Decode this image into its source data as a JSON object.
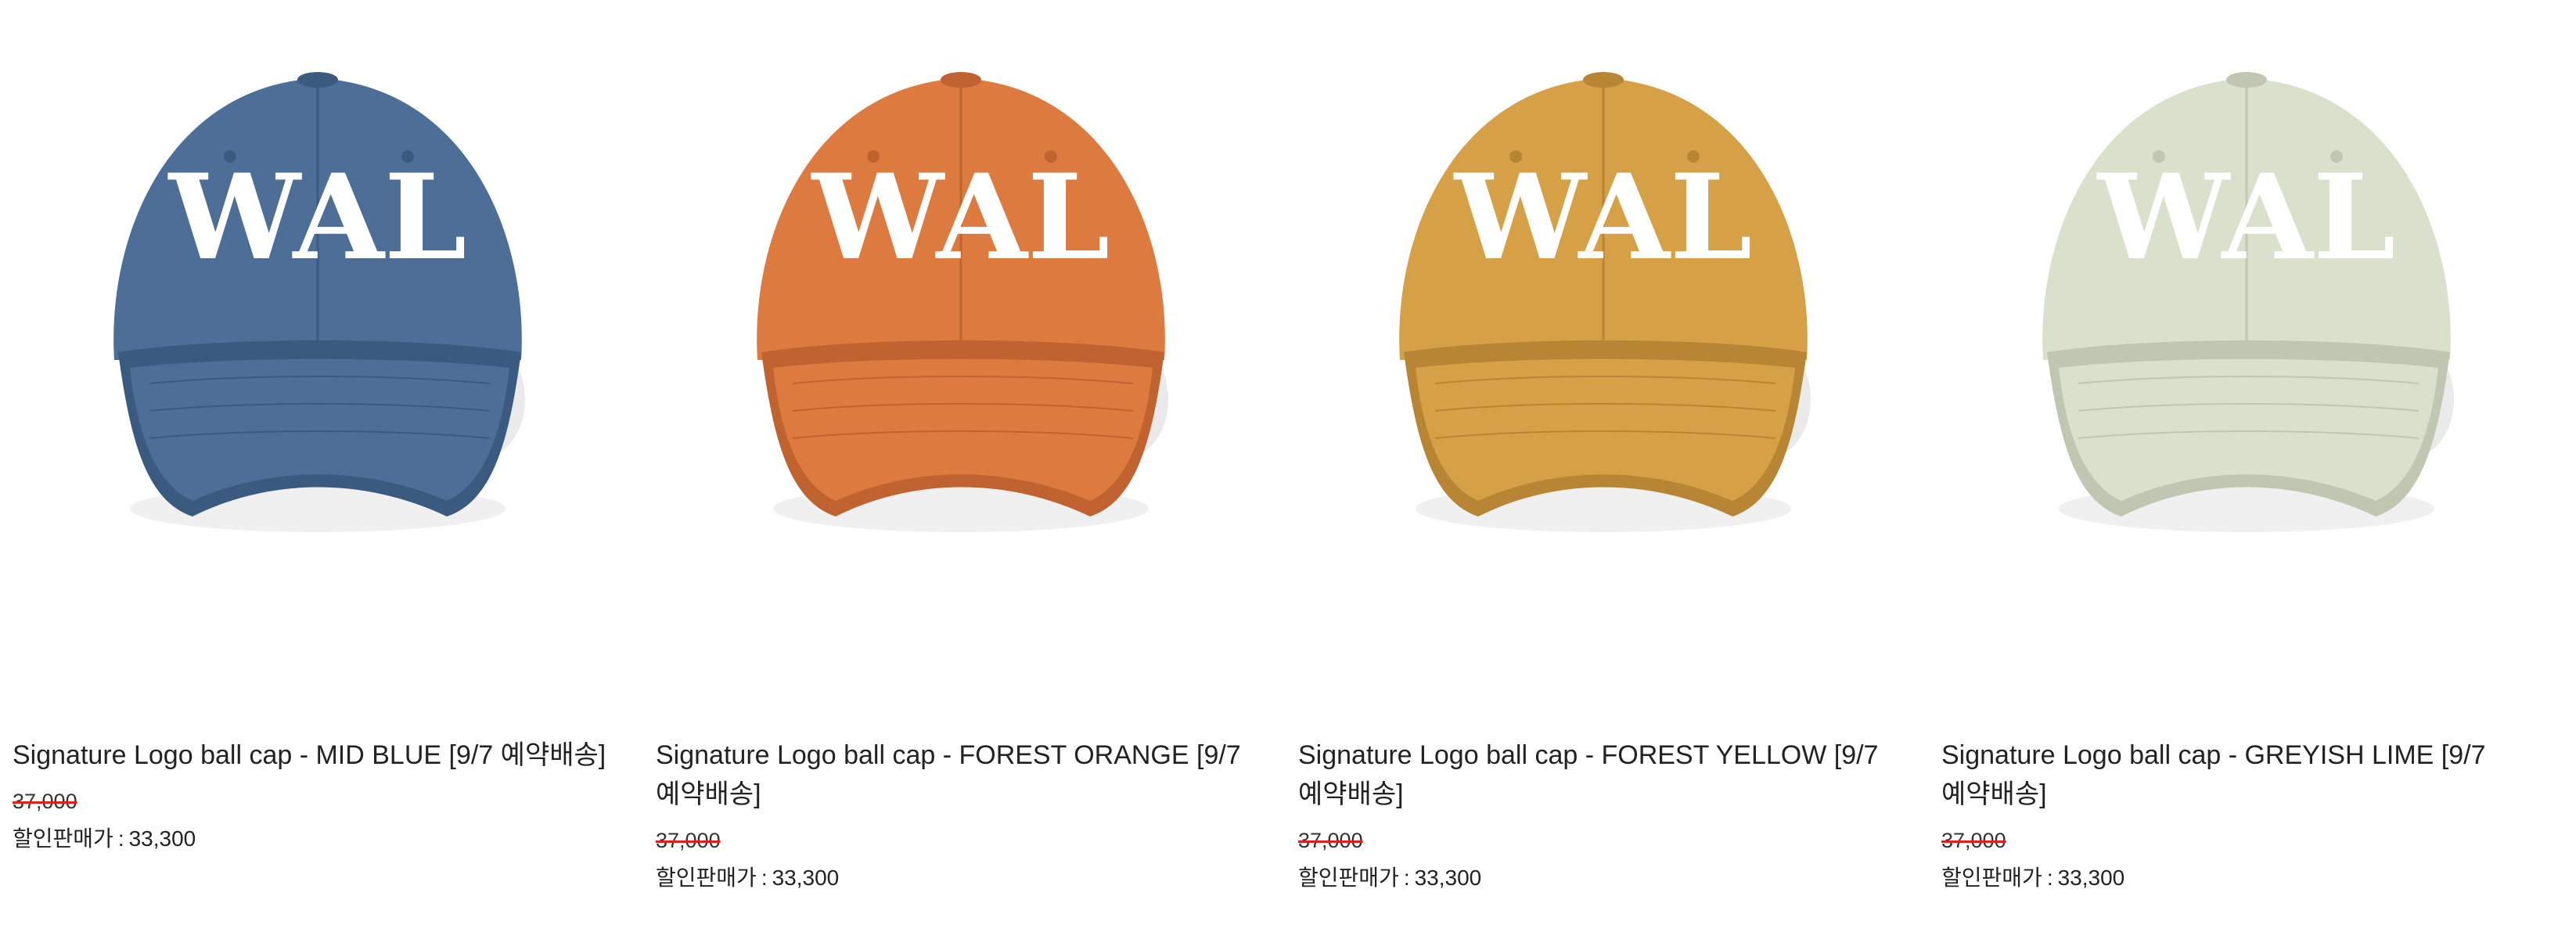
{
  "products": [
    {
      "name": "Signature Logo ball cap - MID BLUE [9/7 예약배송]",
      "original_price": "37,000",
      "sale_label": "할인판매가",
      "sale_separator": ":",
      "sale_price": "33,300",
      "cap_color": "#4c6e97",
      "cap_shade": "#3a5a80",
      "image_icon": "blue-cap-image"
    },
    {
      "name": "Signature Logo ball cap - FOREST ORANGE [9/7 예약배송]",
      "original_price": "37,000",
      "sale_label": "할인판매가",
      "sale_separator": ":",
      "sale_price": "33,300",
      "cap_color": "#dd7a3f",
      "cap_shade": "#c06330",
      "image_icon": "orange-cap-image"
    },
    {
      "name": "Signature Logo ball cap - FOREST YELLOW [9/7 예약배송]",
      "original_price": "37,000",
      "sale_label": "할인판매가",
      "sale_separator": ":",
      "sale_price": "33,300",
      "cap_color": "#d6a046",
      "cap_shade": "#b88535",
      "image_icon": "yellow-cap-image"
    },
    {
      "name": "Signature Logo ball cap - GREYISH LIME [9/7 예약배송]",
      "original_price": "37,000",
      "sale_label": "할인판매가",
      "sale_separator": ":",
      "sale_price": "33,300",
      "cap_color": "#d9e0cc",
      "cap_shade": "#bfc7b2",
      "image_icon": "lime-cap-image"
    }
  ],
  "colors": {
    "strike_red": "#e0201a",
    "text": "#222222"
  }
}
